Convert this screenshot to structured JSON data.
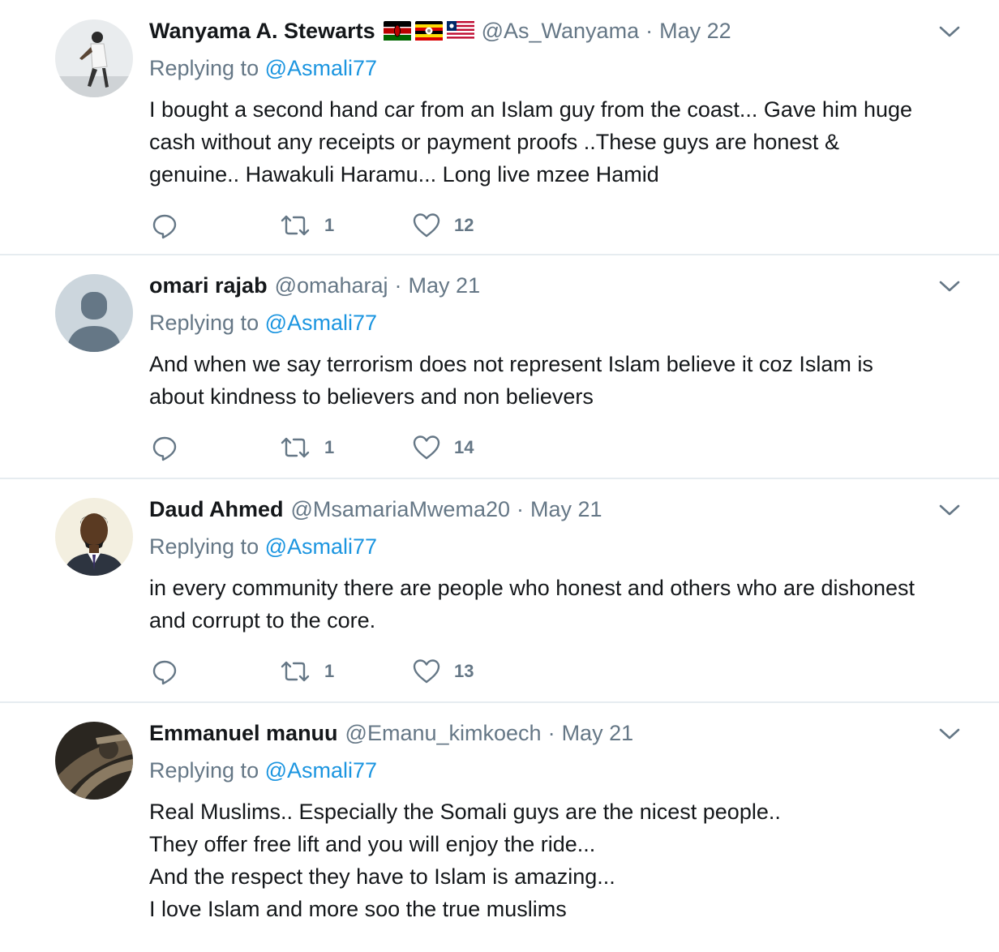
{
  "colors": {
    "text": "#14171a",
    "secondary": "#657786",
    "link": "#1b95e0",
    "divider": "#e6ecf0"
  },
  "tweets": [
    {
      "name": "Wanyama A. Stewarts",
      "flags": [
        "kenya-flag",
        "uganda-flag",
        "liberia-flag"
      ],
      "handle": "@As_Wanyama",
      "separator": "·",
      "date": "May 22",
      "replying_prefix": "Replying to",
      "replying_to": "@Asmali77",
      "text_lines": [
        "I bought a second hand car from an Islam guy from the coast... Gave him huge",
        "cash without any receipts or payment proofs ..These guys are honest &",
        "genuine.. Hawakuli Haramu... Long live mzee Hamid"
      ],
      "retweets": "1",
      "likes": "12"
    },
    {
      "name": "omari rajab",
      "handle": "@omaharaj",
      "separator": "·",
      "date": "May 21",
      "replying_prefix": "Replying to",
      "replying_to": "@Asmali77",
      "text_lines": [
        "And when we say terrorism does not represent Islam believe it coz Islam is",
        "about kindness to believers and non believers"
      ],
      "retweets": "1",
      "likes": "14"
    },
    {
      "name": "Daud Ahmed",
      "handle": "@MsamariaMwema20",
      "separator": "·",
      "date": "May 21",
      "replying_prefix": "Replying to",
      "replying_to": "@Asmali77",
      "text_lines": [
        "in every community there are people who honest and others who are dishonest",
        "and corrupt to the core."
      ],
      "retweets": "1",
      "likes": "13"
    },
    {
      "name": "Emmanuel manuu",
      "handle": "@Emanu_kimkoech",
      "separator": "·",
      "date": "May 21",
      "replying_prefix": "Replying to",
      "replying_to": "@Asmali77",
      "text_lines": [
        "Real Muslims.. Especially the Somali guys are the nicest people..",
        "They offer free lift and you will enjoy the ride...",
        "And the respect they have to Islam is amazing...",
        "I love Islam and more soo the true muslims"
      ]
    }
  ]
}
